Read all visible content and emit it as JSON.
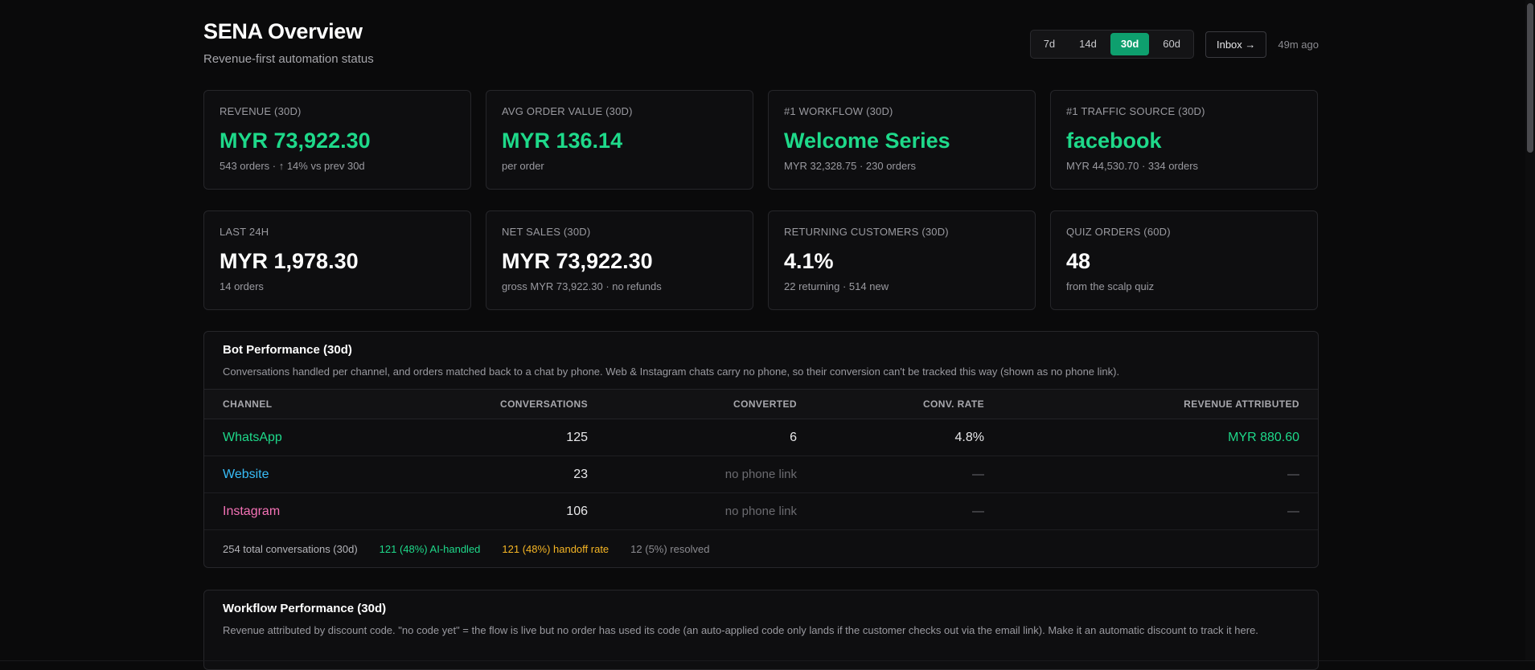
{
  "header": {
    "title": "SENA Overview",
    "subtitle": "Revenue-first automation status",
    "ranges": [
      "7d",
      "14d",
      "30d",
      "60d"
    ],
    "active_range": "30d",
    "inbox_label": "Inbox →",
    "updated": "49m ago"
  },
  "kpis_row1": [
    {
      "label": "REVENUE (30D)",
      "value": "MYR 73,922.30",
      "sub": "543 orders · ↑ 14% vs prev 30d",
      "accent": true
    },
    {
      "label": "AVG ORDER VALUE (30D)",
      "value": "MYR 136.14",
      "sub": "per order",
      "accent": true
    },
    {
      "label": "#1 WORKFLOW (30D)",
      "value": "Welcome Series",
      "sub": "MYR 32,328.75 · 230 orders",
      "accent": true
    },
    {
      "label": "#1 TRAFFIC SOURCE (30D)",
      "value": "facebook",
      "sub": "MYR 44,530.70 · 334 orders",
      "accent": true
    }
  ],
  "kpis_row2": [
    {
      "label": "LAST 24H",
      "value": "MYR 1,978.30",
      "sub": "14 orders"
    },
    {
      "label": "NET SALES (30D)",
      "value": "MYR 73,922.30",
      "sub": "gross MYR 73,922.30 · no refunds"
    },
    {
      "label": "RETURNING CUSTOMERS (30D)",
      "value": "4.1%",
      "sub": "22 returning · 514 new"
    },
    {
      "label": "QUIZ ORDERS (60D)",
      "value": "48",
      "sub": "from the scalp quiz"
    }
  ],
  "bot_performance": {
    "title": "Bot Performance (30d)",
    "description": "Conversations handled per channel, and orders matched back to a chat by phone. Web & Instagram chats carry no phone, so their conversion can't be tracked this way (shown as no phone link).",
    "columns": [
      "CHANNEL",
      "CONVERSATIONS",
      "CONVERTED",
      "CONV. RATE",
      "REVENUE ATTRIBUTED"
    ],
    "rows": [
      {
        "channel": "WhatsApp",
        "conversations": "125",
        "converted": "6",
        "rate": "4.8%",
        "revenue": "MYR 880.60"
      },
      {
        "channel": "Website",
        "conversations": "23",
        "converted": "no phone link",
        "rate": "—",
        "revenue": "—"
      },
      {
        "channel": "Instagram",
        "conversations": "106",
        "converted": "no phone link",
        "rate": "—",
        "revenue": "—"
      }
    ],
    "footer": {
      "total": "254 total conversations (30d)",
      "ai": "121 (48%) AI-handled",
      "handoff": "121 (48%) handoff rate",
      "resolved": "12 (5%) resolved"
    }
  },
  "workflow_performance": {
    "title": "Workflow Performance (30d)",
    "description": "Revenue attributed by discount code. \"no code yet\" = the flow is live but no order has used its code (an auto-applied code only lands if the customer checks out via the email link). Make it an automatic discount to track it here."
  },
  "colors": {
    "accent_green": "#1ed98a",
    "active_range_bg": "#0e9f6e",
    "website_blue": "#38bdf8",
    "instagram_pink": "#f472b6",
    "handoff_amber": "#f5b524"
  }
}
